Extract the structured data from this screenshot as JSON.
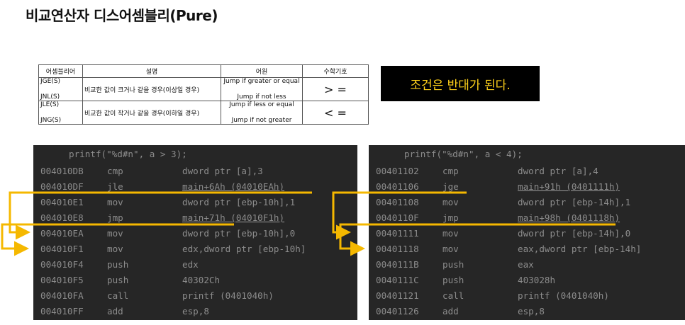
{
  "title": "비교연산자 디스어셈블리(Pure)",
  "table": {
    "headers": [
      "어셈블리어",
      "설명",
      "어원",
      "수학기호"
    ],
    "rows": [
      {
        "mnemonic_top": "JGE(S)",
        "mnemonic_bottom": "JNL(S)",
        "description": "비교한 값이 크거나 같을 경우(이상일 경우)",
        "origin_top": "Jump if greater or equal",
        "origin_bottom": "Jump if not less",
        "symbol": "> ="
      },
      {
        "mnemonic_top": "JLE(S)",
        "mnemonic_bottom": "JNG(S)",
        "description": "비교한 값이 작거나 같을 경우(이하일 경우)",
        "origin_top": "Jump if less or equal",
        "origin_bottom": "Jump if not greater",
        "symbol": "< ="
      }
    ]
  },
  "note": "조건은 반대가 된다.",
  "colors": {
    "code_bg": "#262626",
    "code_text": "#8c8c8c",
    "arrow": "#f5b800",
    "note_text": "#ffd11a"
  },
  "code_left": {
    "header": "printf(\"%d#n\", a > 3);",
    "lines": [
      {
        "addr": "004010DB",
        "mn": "cmp",
        "op": "dword ptr [a],3"
      },
      {
        "addr": "004010DF",
        "mn": "jle",
        "op": "main+6Ah (04010EAh)"
      },
      {
        "addr": "004010E1",
        "mn": "mov",
        "op": "dword ptr [ebp-10h],1"
      },
      {
        "addr": "004010E8",
        "mn": "jmp",
        "op": "main+71h (04010F1h)"
      },
      {
        "addr": "004010EA",
        "mn": "mov",
        "op": "dword ptr [ebp-10h],0"
      },
      {
        "addr": "004010F1",
        "mn": "mov",
        "op": "edx,dword ptr [ebp-10h]"
      },
      {
        "addr": "004010F4",
        "mn": "push",
        "op": "edx"
      },
      {
        "addr": "004010F5",
        "mn": "push",
        "op": "40302Ch"
      },
      {
        "addr": "004010FA",
        "mn": "call",
        "op": "printf (0401040h)"
      },
      {
        "addr": "004010FF",
        "mn": "add",
        "op": "esp,8"
      }
    ]
  },
  "code_right": {
    "header": "printf(\"%d#n\", a < 4);",
    "lines": [
      {
        "addr": "00401102",
        "mn": "cmp",
        "op": "dword ptr [a],4"
      },
      {
        "addr": "00401106",
        "mn": "jge",
        "op": "main+91h (0401111h)"
      },
      {
        "addr": "00401108",
        "mn": "mov",
        "op": "dword ptr [ebp-14h],1"
      },
      {
        "addr": "0040110F",
        "mn": "jmp",
        "op": "main+98h (0401118h)"
      },
      {
        "addr": "00401111",
        "mn": "mov",
        "op": "dword ptr [ebp-14h],0"
      },
      {
        "addr": "00401118",
        "mn": "mov",
        "op": "eax,dword ptr [ebp-14h]"
      },
      {
        "addr": "0040111B",
        "mn": "push",
        "op": "eax"
      },
      {
        "addr": "0040111C",
        "mn": "push",
        "op": "403028h"
      },
      {
        "addr": "00401121",
        "mn": "call",
        "op": "printf (0401040h)"
      },
      {
        "addr": "00401126",
        "mn": "add",
        "op": "esp,8"
      }
    ]
  }
}
